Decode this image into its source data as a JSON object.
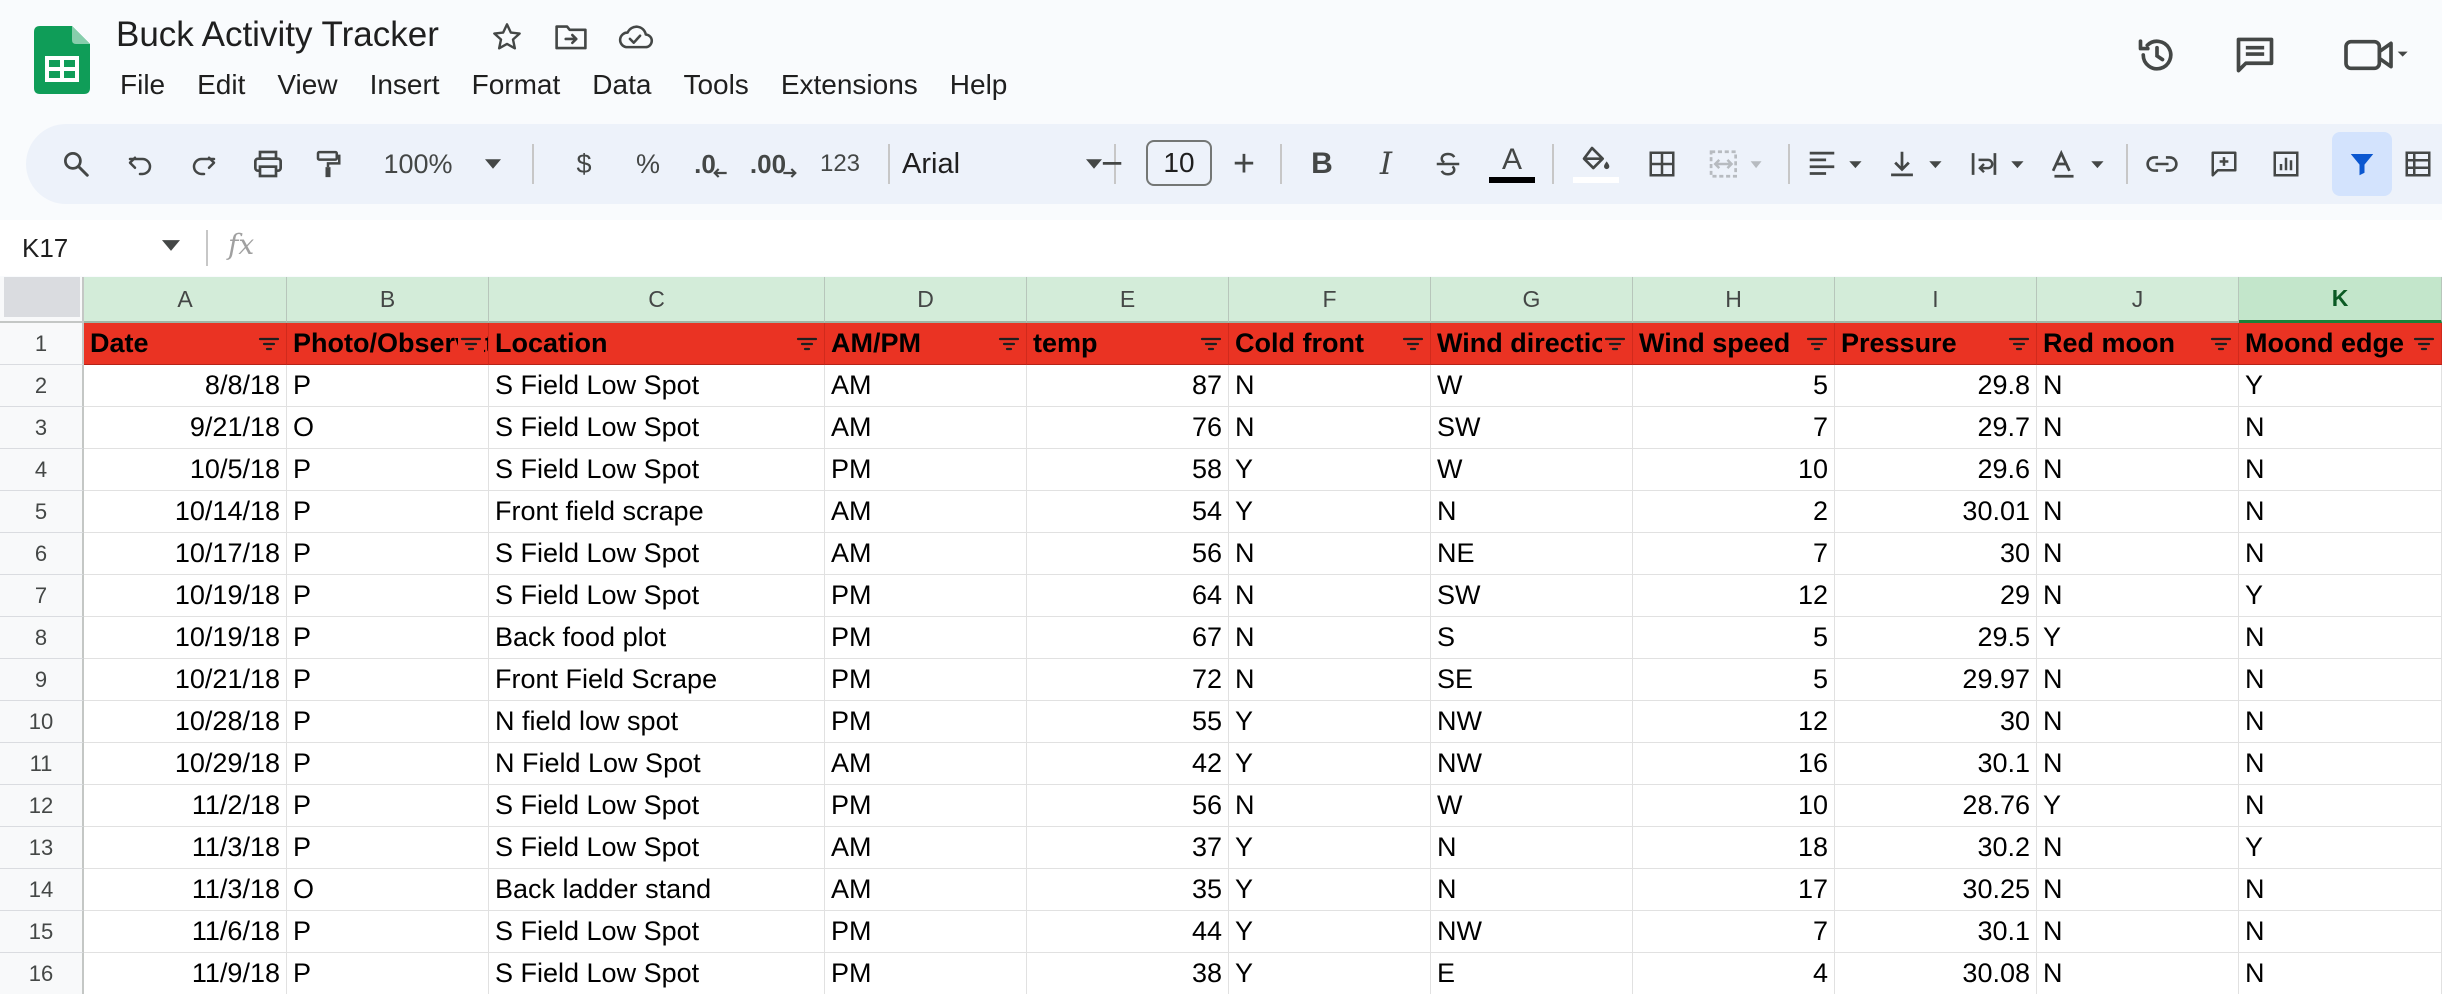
{
  "app": {
    "title": "Buck Activity Tracker"
  },
  "icons": {
    "logo": "google-sheets-logo",
    "star": "star-icon",
    "move": "move-to-folder-icon",
    "cloud": "cloud-status-icon",
    "history": "version-history-icon",
    "comments": "comments-icon",
    "meet": "meet-camera-icon"
  },
  "menu": [
    "File",
    "Edit",
    "View",
    "Insert",
    "Format",
    "Data",
    "Tools",
    "Extensions",
    "Help"
  ],
  "toolbar": {
    "zoom": "100%",
    "currency": "$",
    "percent": "%",
    "decrease_decimal": ".0",
    "increase_decimal": ".00",
    "number_format": "123",
    "font": "Arial",
    "font_size": "10",
    "minus": "−",
    "plus": "+",
    "bold": "B",
    "italic": "I",
    "text_color": "A"
  },
  "formula_bar": {
    "name_box": "K17",
    "fx": "fx",
    "value": ""
  },
  "colors": {
    "header_fill": "#ea3323",
    "col_header_fill": "#d3ecd9",
    "active_filter": "#d3e3fd"
  },
  "sheet": {
    "selected_column": "K",
    "columns": [
      "A",
      "B",
      "C",
      "D",
      "E",
      "F",
      "G",
      "H",
      "I",
      "J",
      "K"
    ],
    "headers": [
      "Date",
      "Photo/Observation",
      "Location",
      "AM/PM",
      "temp",
      "Cold front",
      "Wind direction",
      "Wind speed",
      "Pressure",
      "Red moon",
      "Moond edge"
    ],
    "rows": [
      {
        "num": "1",
        "cells": []
      },
      {
        "num": "2",
        "cells": [
          "8/8/18",
          "P",
          "S Field Low Spot",
          "AM",
          "87",
          "N",
          "W",
          "5",
          "29.8",
          "N",
          "Y"
        ]
      },
      {
        "num": "3",
        "cells": [
          "9/21/18",
          "O",
          "S Field Low Spot",
          "AM",
          "76",
          "N",
          "SW",
          "7",
          "29.7",
          "N",
          "N"
        ]
      },
      {
        "num": "4",
        "cells": [
          "10/5/18",
          "P",
          "S Field Low Spot",
          "PM",
          "58",
          "Y",
          "W",
          "10",
          "29.6",
          "N",
          "N"
        ]
      },
      {
        "num": "5",
        "cells": [
          "10/14/18",
          "P",
          "Front field scrape",
          "AM",
          "54",
          "Y",
          "N",
          "2",
          "30.01",
          "N",
          "N"
        ]
      },
      {
        "num": "6",
        "cells": [
          "10/17/18",
          "P",
          "S Field Low Spot",
          "AM",
          "56",
          "N",
          "NE",
          "7",
          "30",
          "N",
          "N"
        ]
      },
      {
        "num": "7",
        "cells": [
          "10/19/18",
          "P",
          "S Field Low Spot",
          "PM",
          "64",
          "N",
          "SW",
          "12",
          "29",
          "N",
          "Y"
        ]
      },
      {
        "num": "8",
        "cells": [
          "10/19/18",
          "P",
          "Back food plot",
          "PM",
          "67",
          "N",
          "S",
          "5",
          "29.5",
          "Y",
          "N"
        ]
      },
      {
        "num": "9",
        "cells": [
          "10/21/18",
          "P",
          "Front Field Scrape",
          "PM",
          "72",
          "N",
          "SE",
          "5",
          "29.97",
          "N",
          "N"
        ]
      },
      {
        "num": "10",
        "cells": [
          "10/28/18",
          "P",
          "N field low spot",
          "PM",
          "55",
          "Y",
          "NW",
          "12",
          "30",
          "N",
          "N"
        ]
      },
      {
        "num": "11",
        "cells": [
          "10/29/18",
          "P",
          "N Field Low Spot",
          "AM",
          "42",
          "Y",
          "NW",
          "16",
          "30.1",
          "N",
          "N"
        ]
      },
      {
        "num": "12",
        "cells": [
          "11/2/18",
          "P",
          "S Field Low Spot",
          "PM",
          "56",
          "N",
          "W",
          "10",
          "28.76",
          "Y",
          "N"
        ]
      },
      {
        "num": "13",
        "cells": [
          "11/3/18",
          "P",
          "S Field Low Spot",
          "AM",
          "37",
          "Y",
          "N",
          "18",
          "30.2",
          "N",
          "Y"
        ]
      },
      {
        "num": "14",
        "cells": [
          "11/3/18",
          "O",
          "Back ladder stand",
          "AM",
          "35",
          "Y",
          "N",
          "17",
          "30.25",
          "N",
          "N"
        ]
      },
      {
        "num": "15",
        "cells": [
          "11/6/18",
          "P",
          "S Field Low Spot",
          "PM",
          "44",
          "Y",
          "NW",
          "7",
          "30.1",
          "N",
          "N"
        ]
      },
      {
        "num": "16",
        "cells": [
          "11/9/18",
          "P",
          "S Field Low Spot",
          "PM",
          "38",
          "Y",
          "E",
          "4",
          "30.08",
          "N",
          "N"
        ]
      }
    ]
  }
}
